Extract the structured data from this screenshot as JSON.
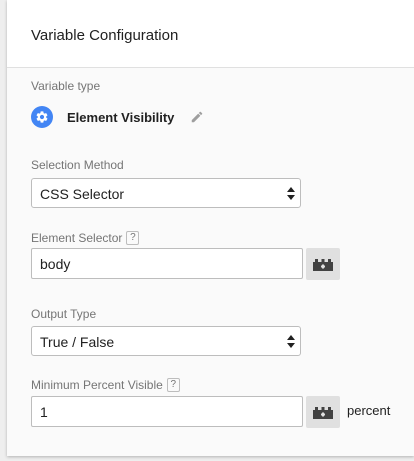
{
  "header": {
    "title": "Variable Configuration"
  },
  "variable_type": {
    "label": "Variable type",
    "name": "Element Visibility",
    "icon": "gear-icon",
    "icon_color": "#4285f4",
    "edit_icon": "pencil-icon"
  },
  "selection_method": {
    "label": "Selection Method",
    "value": "CSS Selector"
  },
  "element_selector": {
    "label": "Element Selector",
    "help": "?",
    "value": "body",
    "variable_button_icon": "lego-brick-icon"
  },
  "output_type": {
    "label": "Output Type",
    "value": "True / False"
  },
  "min_percent_visible": {
    "label": "Minimum Percent Visible",
    "help": "?",
    "value": "1",
    "variable_button_icon": "lego-brick-icon",
    "suffix": "percent"
  }
}
